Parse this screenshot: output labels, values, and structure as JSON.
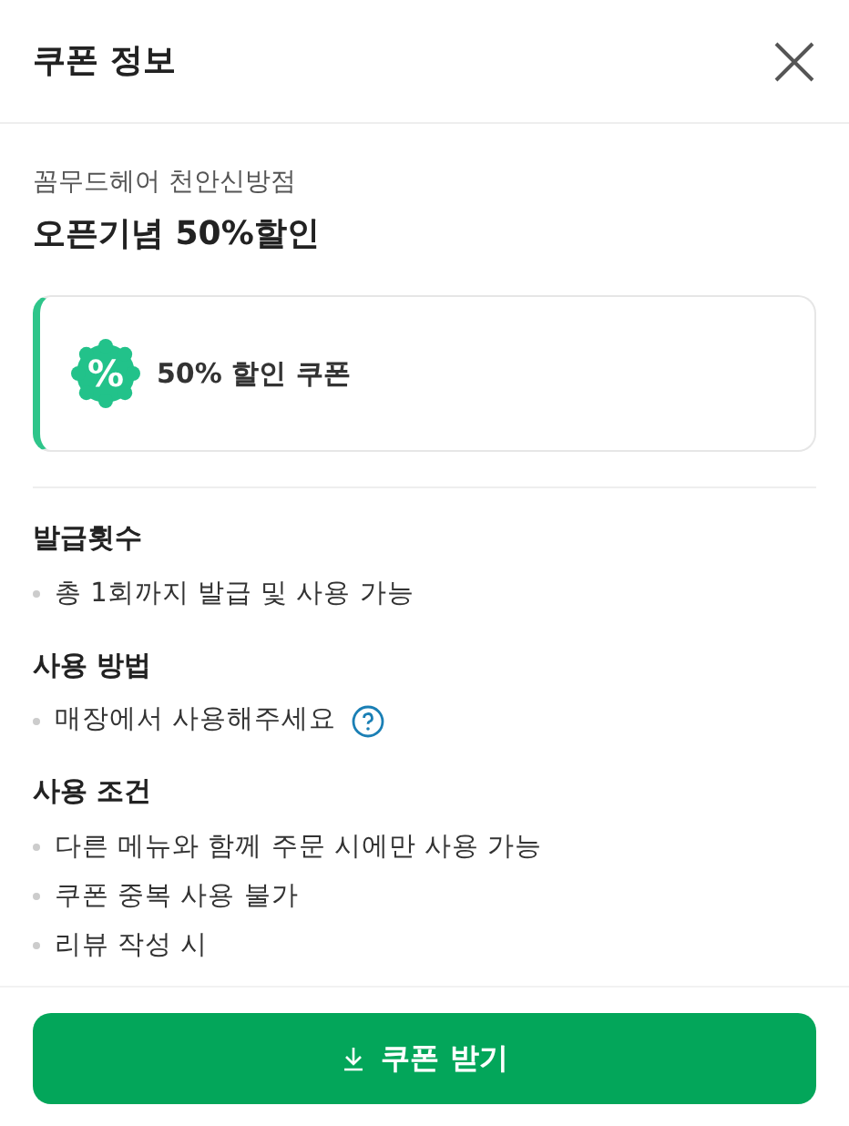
{
  "header": {
    "title": "쿠폰 정보"
  },
  "store": {
    "name": "꼼무드헤어 천안신방점",
    "event": "오픈기념 50%할인"
  },
  "coupon": {
    "label": "50% 할인 쿠폰",
    "symbol": "%"
  },
  "sections": [
    {
      "heading": "발급횟수",
      "items": [
        {
          "text": "총 1회까지 발급 및 사용 가능",
          "help": false
        }
      ]
    },
    {
      "heading": "사용 방법",
      "items": [
        {
          "text": "매장에서 사용해주세요",
          "help": true
        }
      ]
    },
    {
      "heading": "사용 조건",
      "items": [
        {
          "text": "다른 메뉴와 함께 주문 시에만 사용 가능",
          "help": false
        },
        {
          "text": "쿠폰 중복 사용 불가",
          "help": false
        },
        {
          "text": "리뷰 작성 시",
          "help": false
        }
      ]
    }
  ],
  "button": {
    "label": "쿠폰 받기"
  }
}
